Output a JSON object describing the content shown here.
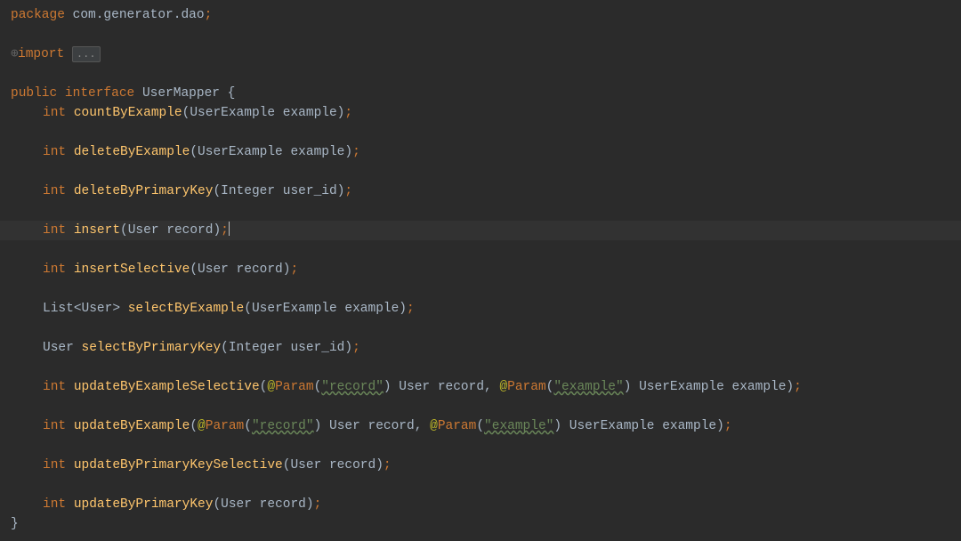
{
  "code": {
    "package_kw": "package",
    "package_name": " com.generator.dao",
    "import_kw": "import",
    "fold_text": "...",
    "public_kw": "public ",
    "interface_kw": "interface",
    "interface_name": " UserMapper ",
    "open_brace": "{",
    "close_brace": "}",
    "int_kw": "int",
    "list_type": "List",
    "user_type": "User",
    "methods": {
      "countByExample": "countByExample",
      "deleteByExample": "deleteByExample",
      "deleteByPrimaryKey": "deleteByPrimaryKey",
      "insert": "insert",
      "insertSelective": "insertSelective",
      "selectByExample": "selectByExample",
      "selectByPrimaryKey": "selectByPrimaryKey",
      "updateByExampleSelective": "updateByExampleSelective",
      "updateByExample": "updateByExample",
      "updateByPrimaryKeySelective": "updateByPrimaryKeySelective",
      "updateByPrimaryKey": "updateByPrimaryKey"
    },
    "params": {
      "userExample": "UserExample example",
      "integerUserId": "Integer user_id",
      "userRecord": "User record",
      "userRecordComma": " User record",
      "userExampleComma": " UserExample example"
    },
    "annotation": {
      "at": "@",
      "name": "Param",
      "record": "\"record\"",
      "example": "\"example\""
    },
    "semi": ";",
    "lparen": "(",
    "rparen": ")",
    "comma": ",",
    "lt": "<",
    "gt": ">"
  }
}
